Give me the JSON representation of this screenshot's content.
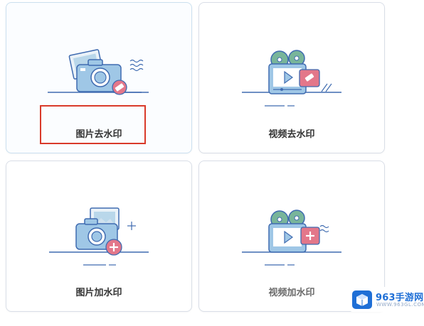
{
  "cards": [
    {
      "label": "图片去水印"
    },
    {
      "label": "视频去水印"
    },
    {
      "label": "图片加水印"
    },
    {
      "label": "视频加水印"
    }
  ],
  "watermark": {
    "brand": "963手游网",
    "url": "WWW.963GL.COM"
  },
  "colors": {
    "icon_blue": "#9fc7e6",
    "icon_stroke": "#3f6bb0",
    "icon_pink": "#e3778a",
    "icon_green": "#78b59a",
    "highlight": "#d93a2a"
  }
}
